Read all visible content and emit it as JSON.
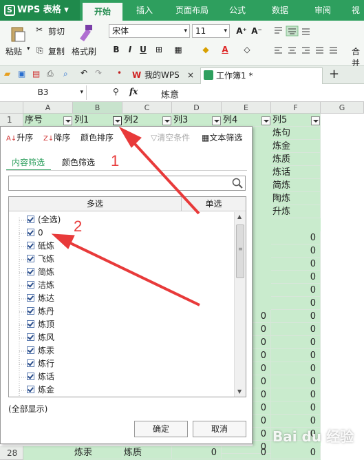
{
  "app": {
    "title": "WPS 表格",
    "logo_letter": "S"
  },
  "menu_tabs": [
    "开始",
    "插入",
    "页面布局",
    "公式",
    "数据",
    "审阅",
    "视"
  ],
  "ribbon": {
    "paste": "粘贴",
    "cut": "剪切",
    "copy": "复制",
    "format_painter": "格式刷",
    "font_name": "宋体",
    "font_size": "11",
    "bold": "B",
    "italic": "I",
    "underline": "U",
    "merge": "合并"
  },
  "doc_tabs": [
    "我的WPS",
    "工作簿1 *"
  ],
  "formula_bar": {
    "cell_ref": "B3",
    "fx": "fx",
    "value": "炼意"
  },
  "columns": [
    "A",
    "B",
    "C",
    "D",
    "E",
    "F",
    "G"
  ],
  "header_row": {
    "row": "1",
    "cells": [
      "序号",
      "列1",
      "列2",
      "列3",
      "列4",
      "列5"
    ]
  },
  "col_f_values": [
    "炼句",
    "炼金",
    "炼质",
    "炼话",
    "简炼",
    "陶炼",
    "升炼"
  ],
  "zero_value": "0",
  "last_row": {
    "row": "28",
    "b": "炼汞",
    "c": "炼质",
    "d": "0",
    "e": "0",
    "f": "0"
  },
  "filter_panel": {
    "sort_asc": "升序",
    "sort_desc": "降序",
    "color_sort": "颜色排序",
    "clear": "清空条件",
    "text_filter": "文本筛选",
    "tab_content": "内容筛选",
    "tab_color": "颜色筛选",
    "col_multi": "多选",
    "col_single": "单选",
    "items": [
      "(全选)",
      "0",
      "砥炼",
      "飞炼",
      "简炼",
      "洁炼",
      "炼达",
      "炼丹",
      "炼顶",
      "炼风",
      "炼汞",
      "炼行",
      "炼话",
      "炼金"
    ],
    "show_all": "(全部显示)",
    "ok": "确定",
    "cancel": "取消"
  },
  "annotations": [
    "1",
    "2"
  ],
  "watermark": "Bai du 经验",
  "colors": {
    "green": "#2e9f5e",
    "cell_green": "#c9ebcd",
    "arrow_red": "#e83a3a"
  }
}
